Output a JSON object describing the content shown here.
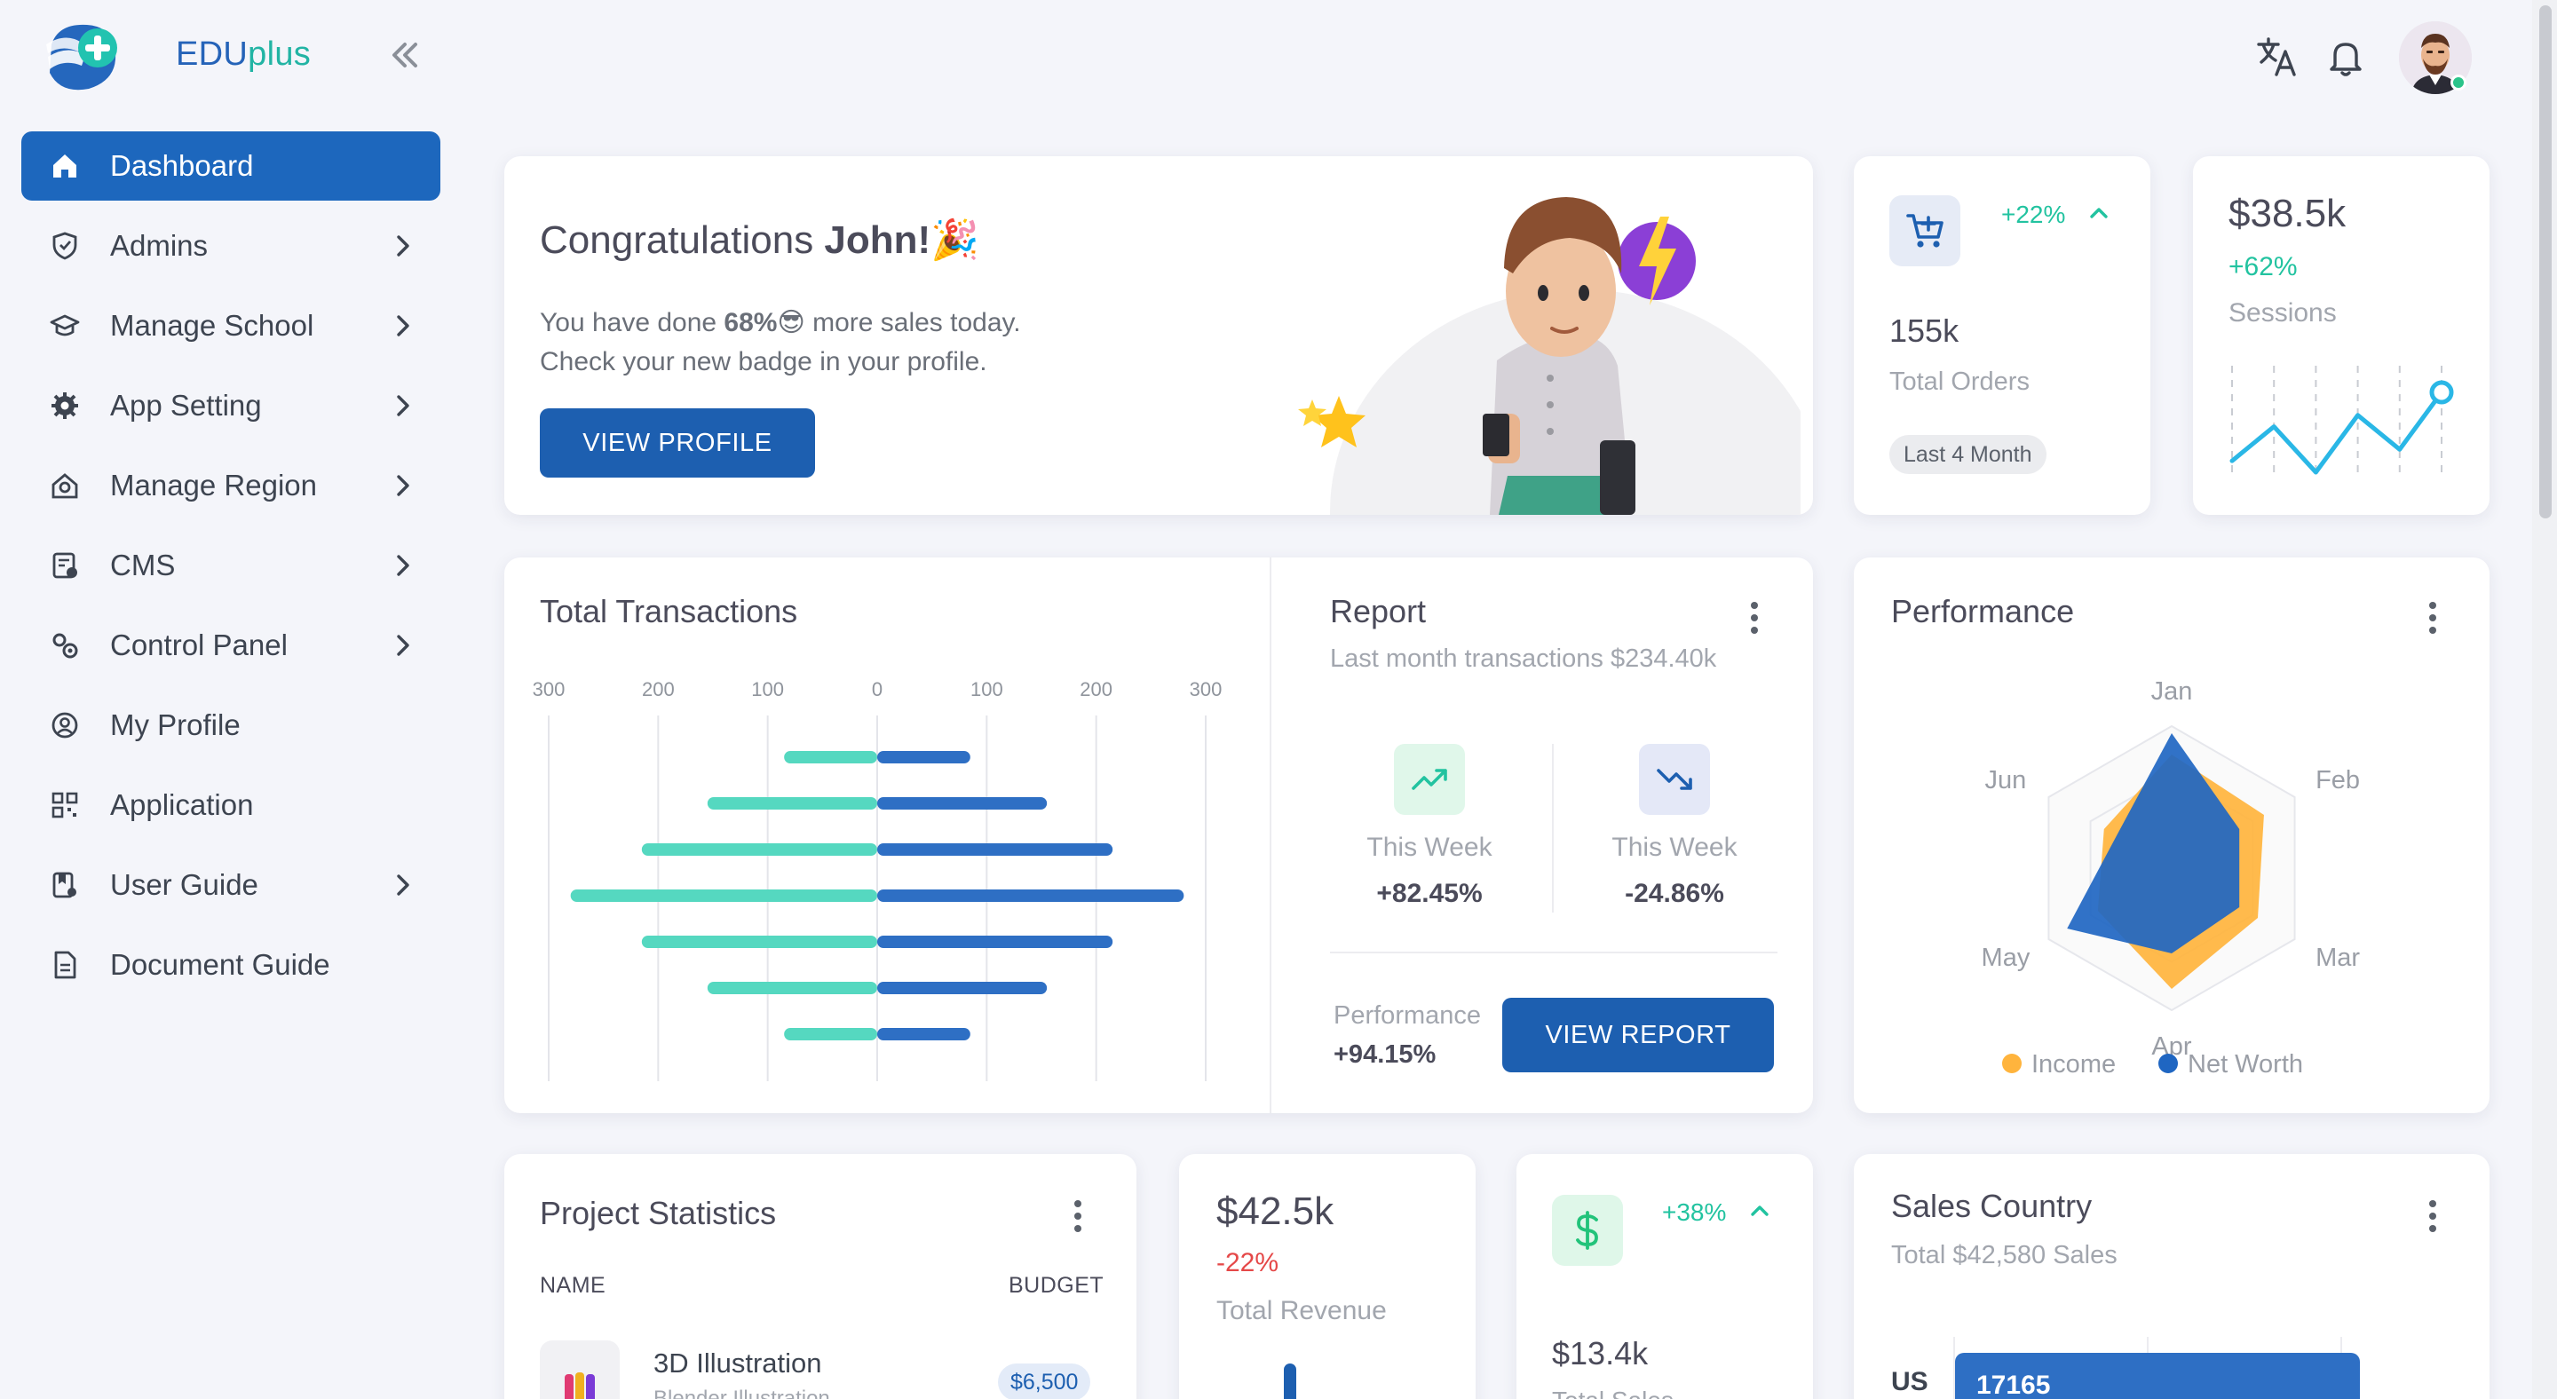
{
  "brand": {
    "name_main": "EDU",
    "name_accent": "plus",
    "accent_color": "#22b4a4",
    "primary_color": "#1d67bd"
  },
  "sidebar": {
    "items": [
      {
        "label": "Dashboard",
        "icon": "home-icon",
        "active": true,
        "has_children": false
      },
      {
        "label": "Admins",
        "icon": "shield-icon",
        "has_children": true
      },
      {
        "label": "Manage School",
        "icon": "school-icon",
        "has_children": true
      },
      {
        "label": "App Setting",
        "icon": "gear-icon",
        "has_children": true
      },
      {
        "label": "Manage Region",
        "icon": "region-icon",
        "has_children": true
      },
      {
        "label": "CMS",
        "icon": "cms-icon",
        "has_children": true
      },
      {
        "label": "Control Panel",
        "icon": "cogs-icon",
        "has_children": true
      },
      {
        "label": "My Profile",
        "icon": "user-circle-icon",
        "has_children": false
      },
      {
        "label": "Application",
        "icon": "qr-icon",
        "has_children": false
      },
      {
        "label": "User Guide",
        "icon": "guide-icon",
        "has_children": true
      },
      {
        "label": "Document Guide",
        "icon": "document-icon",
        "has_children": false
      }
    ]
  },
  "header": {
    "icons": [
      "translate-icon",
      "bell-icon"
    ],
    "status": "online"
  },
  "congrats": {
    "title_prefix": "Congratulations ",
    "title_name": "John!",
    "title_emoji": "🎉",
    "line1_prefix": "You have done ",
    "line1_value": "68%",
    "line1_emoji": "😎",
    "line1_suffix": " more sales today.",
    "line2": "Check your new badge in your profile.",
    "button": "VIEW PROFILE"
  },
  "orders": {
    "change": "+22%",
    "value": "155k",
    "label": "Total Orders",
    "badge": "Last 4 Month",
    "icon": "cart-icon"
  },
  "sessions": {
    "value": "$38.5k",
    "change": "+62%",
    "label": "Sessions",
    "trend": [
      2,
      5,
      1,
      6,
      3,
      8
    ]
  },
  "transactions": {
    "title": "Total Transactions"
  },
  "report": {
    "title": "Report",
    "subtitle": "Last month transactions $234.40k",
    "stats": [
      {
        "label": "This Week",
        "value": "+82.45%",
        "icon": "trend-up-icon"
      },
      {
        "label": "This Week",
        "value": "-24.86%",
        "icon": "trend-down-icon"
      }
    ],
    "perf_label": "Performance",
    "perf_value": "+94.15%",
    "button": "VIEW REPORT"
  },
  "performance": {
    "title": "Performance"
  },
  "project_stats": {
    "title": "Project Statistics",
    "col_name": "NAME",
    "col_budget": "BUDGET",
    "rows": [
      {
        "name": "3D Illustration",
        "sub": "Blender Illustration",
        "budget": "$6,500"
      }
    ]
  },
  "revenue": {
    "value": "$42.5k",
    "change": "-22%",
    "label": "Total Revenue"
  },
  "sales_small": {
    "change": "+38%",
    "value": "$13.4k",
    "label": "Total Sales",
    "icon": "dollar-icon"
  },
  "sales_country": {
    "title": "Sales Country",
    "subtitle": "Total $42,580 Sales",
    "rows": [
      {
        "country": "US",
        "value": "17165"
      }
    ]
  },
  "chart_data": [
    {
      "type": "bar",
      "title": "Total Transactions",
      "orientation": "horizontal-diverging",
      "xlim": [
        -300,
        300
      ],
      "tick_labels": [
        "300",
        "200",
        "100",
        "0",
        "100",
        "200",
        "300"
      ],
      "series": [
        {
          "color": "#55d8c0",
          "values": [
            -85,
            -155,
            -215,
            -280,
            -215,
            -155,
            -85
          ]
        },
        {
          "color": "#2e6fc4",
          "values": [
            85,
            155,
            215,
            280,
            215,
            155,
            85
          ]
        }
      ]
    },
    {
      "type": "radar",
      "title": "Performance",
      "categories": [
        "Jan",
        "Feb",
        "Mar",
        "Apr",
        "May",
        "Jun"
      ],
      "max": 100,
      "series": [
        {
          "name": "Income",
          "color": "#ffb43d",
          "values": [
            80,
            75,
            70,
            85,
            60,
            55
          ]
        },
        {
          "name": "Net Worth",
          "color": "#1f66c2",
          "values": [
            95,
            55,
            55,
            60,
            85,
            45
          ]
        }
      ]
    },
    {
      "type": "bar",
      "title": "Sales Country",
      "orientation": "horizontal",
      "categories": [
        "US"
      ],
      "values": [
        17165
      ],
      "color": "#2e6fc4"
    }
  ]
}
